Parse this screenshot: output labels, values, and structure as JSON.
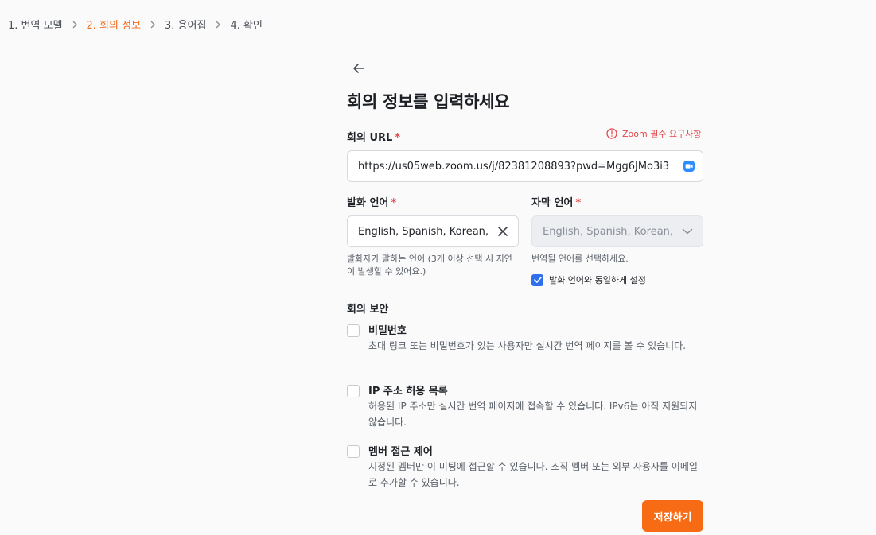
{
  "breadcrumb": {
    "steps": [
      "1. 번역 모델",
      "2. 회의 정보",
      "3. 용어집",
      "4. 확인"
    ]
  },
  "page": {
    "title": "회의 정보를 입력하세요"
  },
  "meeting_url": {
    "label": "회의 URL",
    "required_mark": "*",
    "requirement_note": "Zoom 필수 요구사항",
    "value": "https://us05web.zoom.us/j/82381208893?pwd=Mgg6JMo3i3"
  },
  "spoken_language": {
    "label": "발화 언어",
    "required_mark": "*",
    "value": "English, Spanish, Korean,",
    "help": "발화자가 말하는 언어 (3개 이상 선택 시 지연이 발생할 수 있어요.)"
  },
  "caption_language": {
    "label": "자막 언어",
    "required_mark": "*",
    "value": "English, Spanish, Korean,",
    "help": "번역될 언어를 선택하세요.",
    "same_as_spoken_label": "발화 언어와 동일하게 설정"
  },
  "security": {
    "label": "회의 보안",
    "options": [
      {
        "title": "비밀번호",
        "desc": "초대 링크 또는 비밀번호가 있는 사용자만 실시간 번역 페이지를 볼 수 있습니다."
      },
      {
        "title": "IP 주소 허용 목록",
        "desc": "허용된 IP 주소만 실시간 번역 페이지에 접속할 수 있습니다. IPv6는 아직 지원되지 않습니다."
      },
      {
        "title": "멤버 접근 제어",
        "desc": "지정된 멤버만 이 미팅에 접근할 수 있습니다. 조직 멤버 또는 외부 사용자를 이메일로 추가할 수 있습니다."
      }
    ]
  },
  "actions": {
    "save_label": "저장하기"
  },
  "colors": {
    "accent": "#f76b15",
    "active_step": "#f26b1d",
    "required": "#e5484d",
    "checkbox": "#2f6fed"
  }
}
